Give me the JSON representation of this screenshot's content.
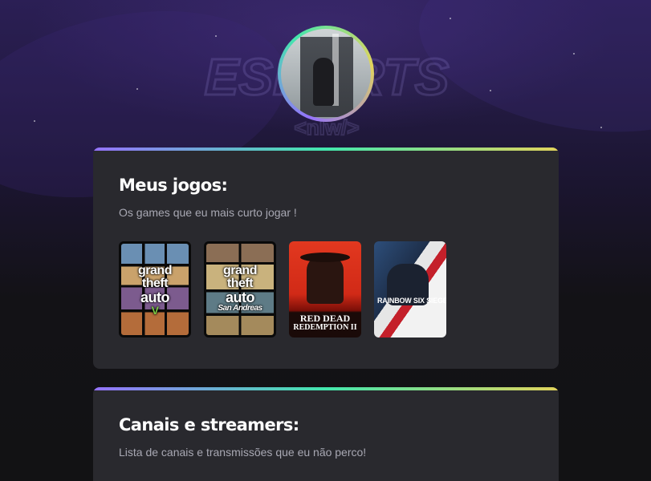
{
  "colors": {
    "accent_gradient": [
      "#9572fc",
      "#43e7ad",
      "#e2d45c"
    ],
    "card_bg": "#29292e",
    "page_bg": "#121214",
    "heading": "#ffffff",
    "muted": "#a8a8b3"
  },
  "background": {
    "logo_text": "ESPORTS",
    "logo_sub": "<nlw/>"
  },
  "profile": {
    "avatar_icon": "profile-photo"
  },
  "games_section": {
    "title": "Meus jogos:",
    "subtitle": "Os games que eu mais curto jogar !",
    "games": [
      {
        "name": "Grand Theft Auto V",
        "cover_line1": "grand",
        "cover_line2": "theft",
        "cover_line3": "auto",
        "cover_mark": "V"
      },
      {
        "name": "Grand Theft Auto San Andreas",
        "cover_line1": "grand",
        "cover_line2": "theft",
        "cover_line3": "auto",
        "cover_mark": "San Andreas"
      },
      {
        "name": "Red Dead Redemption II",
        "cover_line1": "RED DEAD",
        "cover_line2": "REDEMPTION II"
      },
      {
        "name": "Rainbow Six Siege",
        "cover_line1": "RAINBOW SIX SIEGE"
      }
    ]
  },
  "channels_section": {
    "title": "Canais e streamers:",
    "subtitle": "Lista de canais e transmissões que eu não perco!"
  }
}
